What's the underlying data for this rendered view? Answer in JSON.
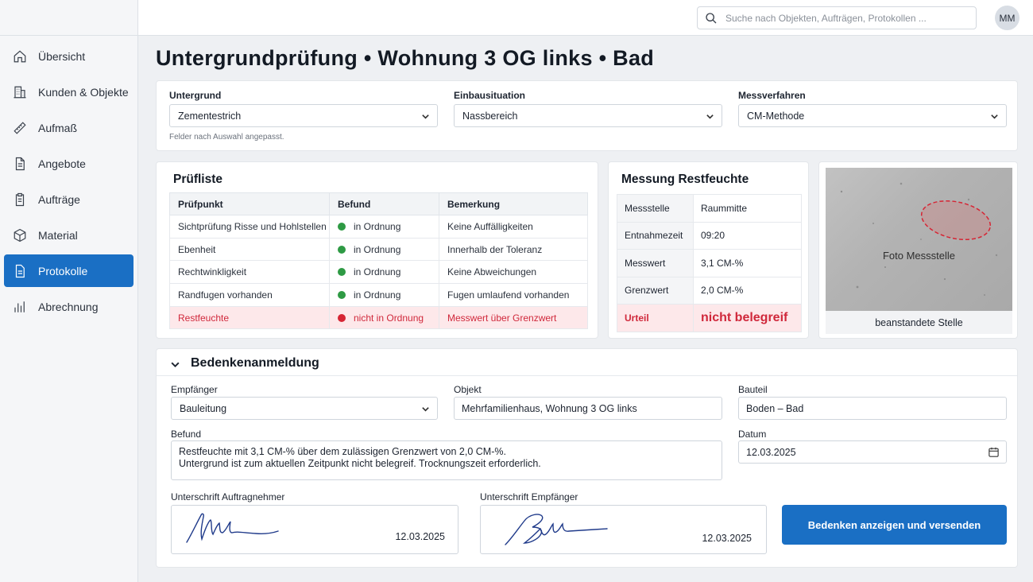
{
  "search": {
    "placeholder": "Suche nach Objekten, Aufträgen, Protokollen ..."
  },
  "user": {
    "initials": "MM"
  },
  "sidebar": {
    "items": [
      {
        "label": "Übersicht",
        "icon": "home-icon"
      },
      {
        "label": "Kunden & Objekte",
        "icon": "building-icon"
      },
      {
        "label": "Aufmaß",
        "icon": "ruler-icon"
      },
      {
        "label": "Angebote",
        "icon": "document-icon"
      },
      {
        "label": "Aufträge",
        "icon": "clipboard-icon"
      },
      {
        "label": "Material",
        "icon": "box-icon"
      },
      {
        "label": "Protokolle",
        "icon": "protocol-icon",
        "active": true
      },
      {
        "label": "Abrechnung",
        "icon": "bar-chart-icon"
      }
    ]
  },
  "page": {
    "title": "Untergrundprüfung • Wohnung 3 OG links • Bad"
  },
  "filters": {
    "untergrund_label": "Untergrund",
    "untergrund_value": "Zementestrich",
    "einbau_label": "Einbausituation",
    "einbau_value": "Nassbereich",
    "mess_label": "Messverfahren",
    "mess_value": "CM-Methode",
    "hint": "Felder nach Auswahl angepasst."
  },
  "pruefliste": {
    "title": "Prüfliste",
    "headers": [
      "Prüfpunkt",
      "Befund",
      "Bemerkung"
    ],
    "rows": [
      {
        "punkt": "Sichtprüfung Risse und Hohlstellen",
        "befund": "in Ordnung",
        "bemerkung": "Keine Auffälligkeiten"
      },
      {
        "punkt": "Ebenheit",
        "befund": "in Ordnung",
        "bemerkung": "Innerhalb der Toleranz"
      },
      {
        "punkt": "Rechtwinkligkeit",
        "befund": "in Ordnung",
        "bemerkung": "Keine Abweichungen"
      },
      {
        "punkt": "Randfugen vorhanden",
        "befund": "in Ordnung",
        "bemerkung": "Fugen umlaufend vorhanden"
      },
      {
        "punkt": "Restfeuchte",
        "befund": "nicht in Ordnung",
        "bemerkung": "Messwert über Grenzwert"
      }
    ]
  },
  "messung": {
    "title": "Messung Restfeuchte",
    "rows": [
      {
        "key": "Messstelle",
        "value": "Raummitte"
      },
      {
        "key": "Entnahmezeit",
        "value": "09:20"
      },
      {
        "key": "Messwert",
        "value": "3,1 CM-%"
      },
      {
        "key": "Grenzwert",
        "value": "2,0 CM-%"
      },
      {
        "key": "Urteil",
        "value": "nicht belegreif"
      }
    ]
  },
  "photo": {
    "label": "Foto Messstelle",
    "caption": "beanstandete Stelle"
  },
  "bedenken": {
    "title": "Bedenkenanmeldung",
    "empfaenger_label": "Empfänger",
    "empfaenger_value": "Bauleitung",
    "objekt_label": "Objekt",
    "objekt_value": "Mehrfamilienhaus, Wohnung 3 OG links",
    "bauteil_label": "Bauteil",
    "bauteil_value": "Boden – Bad",
    "befund_label": "Befund",
    "befund_line1": "Restfeuchte mit 3,1 CM-% über dem zulässigen Grenzwert von 2,0 CM-%.",
    "befund_line2": "Untergrund ist zum aktuellen Zeitpunkt nicht belegreif. Trocknungszeit erforderlich.",
    "datum_label": "Datum",
    "datum_value": "12.03.2025",
    "sig1_label": "Unterschrift Auftragnehmer",
    "sig1_date": "12.03.2025",
    "sig2_label": "Unterschrift Empfänger",
    "sig2_date": "12.03.2025",
    "submit_label": "Bedenken anzeigen und versenden"
  },
  "colors": {
    "accent": "#1a6fc4",
    "ok": "#2e9a44",
    "error": "#d0283b",
    "error_bg": "#fde8ea"
  }
}
